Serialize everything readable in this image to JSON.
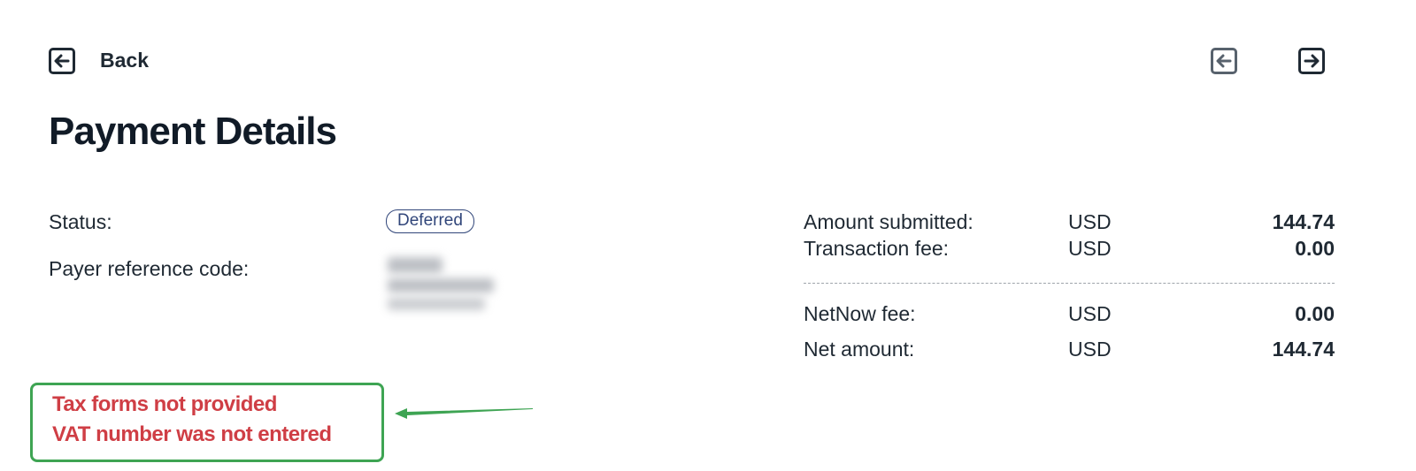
{
  "header": {
    "back_label": "Back",
    "back_icon": "arrow-left-box-icon",
    "prev_icon": "arrow-left-box-icon",
    "next_icon": "arrow-right-box-icon"
  },
  "page": {
    "title": "Payment Details"
  },
  "details": {
    "status_label": "Status:",
    "status_value": "Deferred",
    "payer_label": "Payer reference code:",
    "payer_value": ""
  },
  "amounts": {
    "rows": [
      {
        "label": "Amount submitted:",
        "currency": "USD",
        "value": "144.74"
      },
      {
        "label": "Transaction fee:",
        "currency": "USD",
        "value": "0.00"
      },
      {
        "label": "NetNow fee:",
        "currency": "USD",
        "value": "0.00"
      },
      {
        "label": "Net amount:",
        "currency": "USD",
        "value": "144.74"
      }
    ]
  },
  "annotation": {
    "lines": [
      "Tax forms not provided",
      "VAT number was not entered"
    ]
  },
  "colors": {
    "text": "#1f2933",
    "badge": "#31467a",
    "alert_text": "#cf3e45",
    "annotation_green": "#3ea453"
  }
}
